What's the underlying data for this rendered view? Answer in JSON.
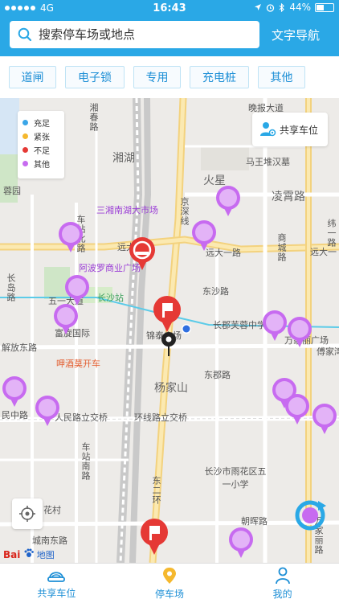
{
  "status_bar": {
    "carrier": "4G",
    "time": "16:43",
    "battery": "44%"
  },
  "search": {
    "placeholder": "搜索停车场或地点",
    "text_nav": "文字导航"
  },
  "filters": [
    "道闸",
    "电子锁",
    "专用",
    "充电桩",
    "其他"
  ],
  "legend": [
    {
      "label": "充足",
      "color": "#3aa6e8"
    },
    {
      "label": "紧张",
      "color": "#f5b82e"
    },
    {
      "label": "不足",
      "color": "#e53935"
    },
    {
      "label": "其他",
      "color": "#c76bf0"
    }
  ],
  "share_spot": {
    "label": "共享车位"
  },
  "map_labels": {
    "xiangchun": "湘春路",
    "xiangbei": "湘湖",
    "yuanlin": "蓉园",
    "mkt": "三湘南湖大市场",
    "chebei": "车站北路",
    "yuandalu": "远大一路",
    "yuandalu2": "远大一路",
    "yuandalu3": "远大一",
    "apollo": "阿波罗商业广场",
    "changsha": "长沙站",
    "changdao": "长岛路",
    "wuyi": "五一大道",
    "jindun": "晚报大道",
    "mawang": "马王堆汉墓",
    "lingcheng": "凌霄路",
    "huoxing": "火星",
    "jingsha": "京深线",
    "dongxiang": "东沙路",
    "shanglu": "商城路",
    "wei1": "纬一路",
    "changjun": "长郡芙蓉中学",
    "jintai": "锦泰广场",
    "wanjia": "万家丽广场",
    "jiefang": "解放东路",
    "fuxuan": "富旋国际",
    "hejiu": "呷酒莫开车",
    "yangjia": "杨家山",
    "dongerl": "东二环",
    "minzhong": "民中路",
    "renmin": "人民路立交桥",
    "huanxian": "环线路立交桥",
    "chezhan": "车站南路",
    "huacun": "花村",
    "yuhua": "长沙市雨花区五一小学",
    "chaohui": "朝晖路",
    "chengnan": "城南东路",
    "fuyuan": "傅家湾",
    "dongbalu": "东郡路",
    "dongling": "东岭",
    "wanlai": "万家丽路"
  },
  "map_brand": {
    "name": "Bai",
    "suffix": "地图"
  },
  "tabs": [
    {
      "label": "共享车位",
      "icon": "car-icon"
    },
    {
      "label": "停车场",
      "icon": "location-pin-icon"
    },
    {
      "label": "我的",
      "icon": "person-icon"
    }
  ],
  "colors": {
    "header": "#2aa8e6",
    "accent": "#1d8fd6",
    "marker_purple": "#c76bf0",
    "marker_red": "#e53935"
  }
}
